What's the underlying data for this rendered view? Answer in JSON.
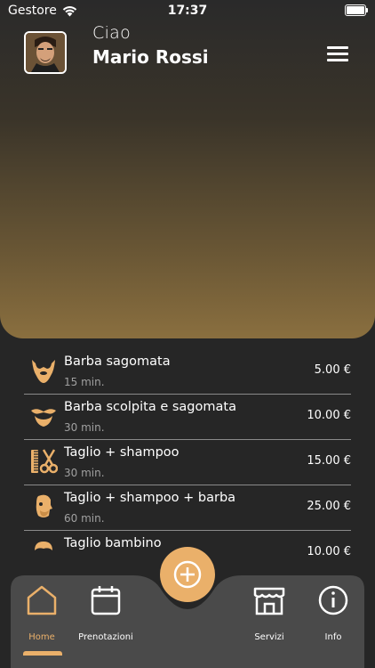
{
  "status_bar": {
    "carrier": "Gestore",
    "time": "17:37"
  },
  "header": {
    "greeting": "Ciao",
    "user_name": "Mario Rossi"
  },
  "services": [
    {
      "name": "Barba sagomata",
      "duration": "15 min.",
      "price": "5.00 €",
      "icon": "beard-icon"
    },
    {
      "name": "Barba scolpita e sagomata",
      "duration": "30 min.",
      "price": "10.00 €",
      "icon": "mustache-beard-icon"
    },
    {
      "name": "Taglio + shampoo",
      "duration": "30 min.",
      "price": "15.00 €",
      "icon": "comb-scissors-icon"
    },
    {
      "name": "Taglio + shampoo + barba",
      "duration": "60 min.",
      "price": "25.00 €",
      "icon": "bearded-head-icon"
    },
    {
      "name": "Taglio bambino",
      "duration": "",
      "price": "10.00 €",
      "icon": "child-hair-icon"
    }
  ],
  "tabbar": {
    "home": "Home",
    "bookings": "Prenotazioni",
    "services": "Servizi",
    "info": "Info",
    "accent": "#eab06a"
  },
  "colors": {
    "background": "#262626",
    "accent": "#eab06a",
    "hero_bottom": "#8a6f3f"
  }
}
